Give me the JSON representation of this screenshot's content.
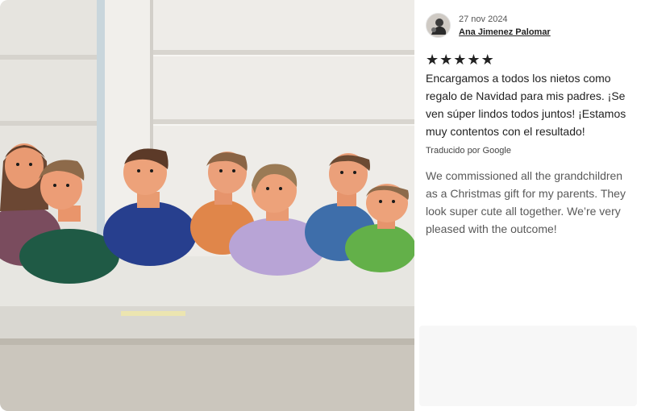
{
  "review": {
    "date": "27 nov 2024",
    "reviewer_name": "Ana Jimenez Palomar",
    "rating": 5,
    "star_glyph": "★",
    "original_text": "Encargamos a todos los nietos como regalo de Navidad para mis padres. ¡Se ven súper lindos todos juntos! ¡Estamos muy contentos con el resultado!",
    "translated_label": "Traducido por Google",
    "translated_text": "We commissioned all the grandchildren as a Christmas gift for my parents. They look super cute all together. We’re very pleased with the outcome!"
  },
  "icons": {
    "star": "star-icon",
    "avatar": "avatar-image"
  },
  "colors": {
    "text_primary": "#222222",
    "text_secondary": "#595959",
    "placeholder_bg": "#f7f7f7"
  }
}
